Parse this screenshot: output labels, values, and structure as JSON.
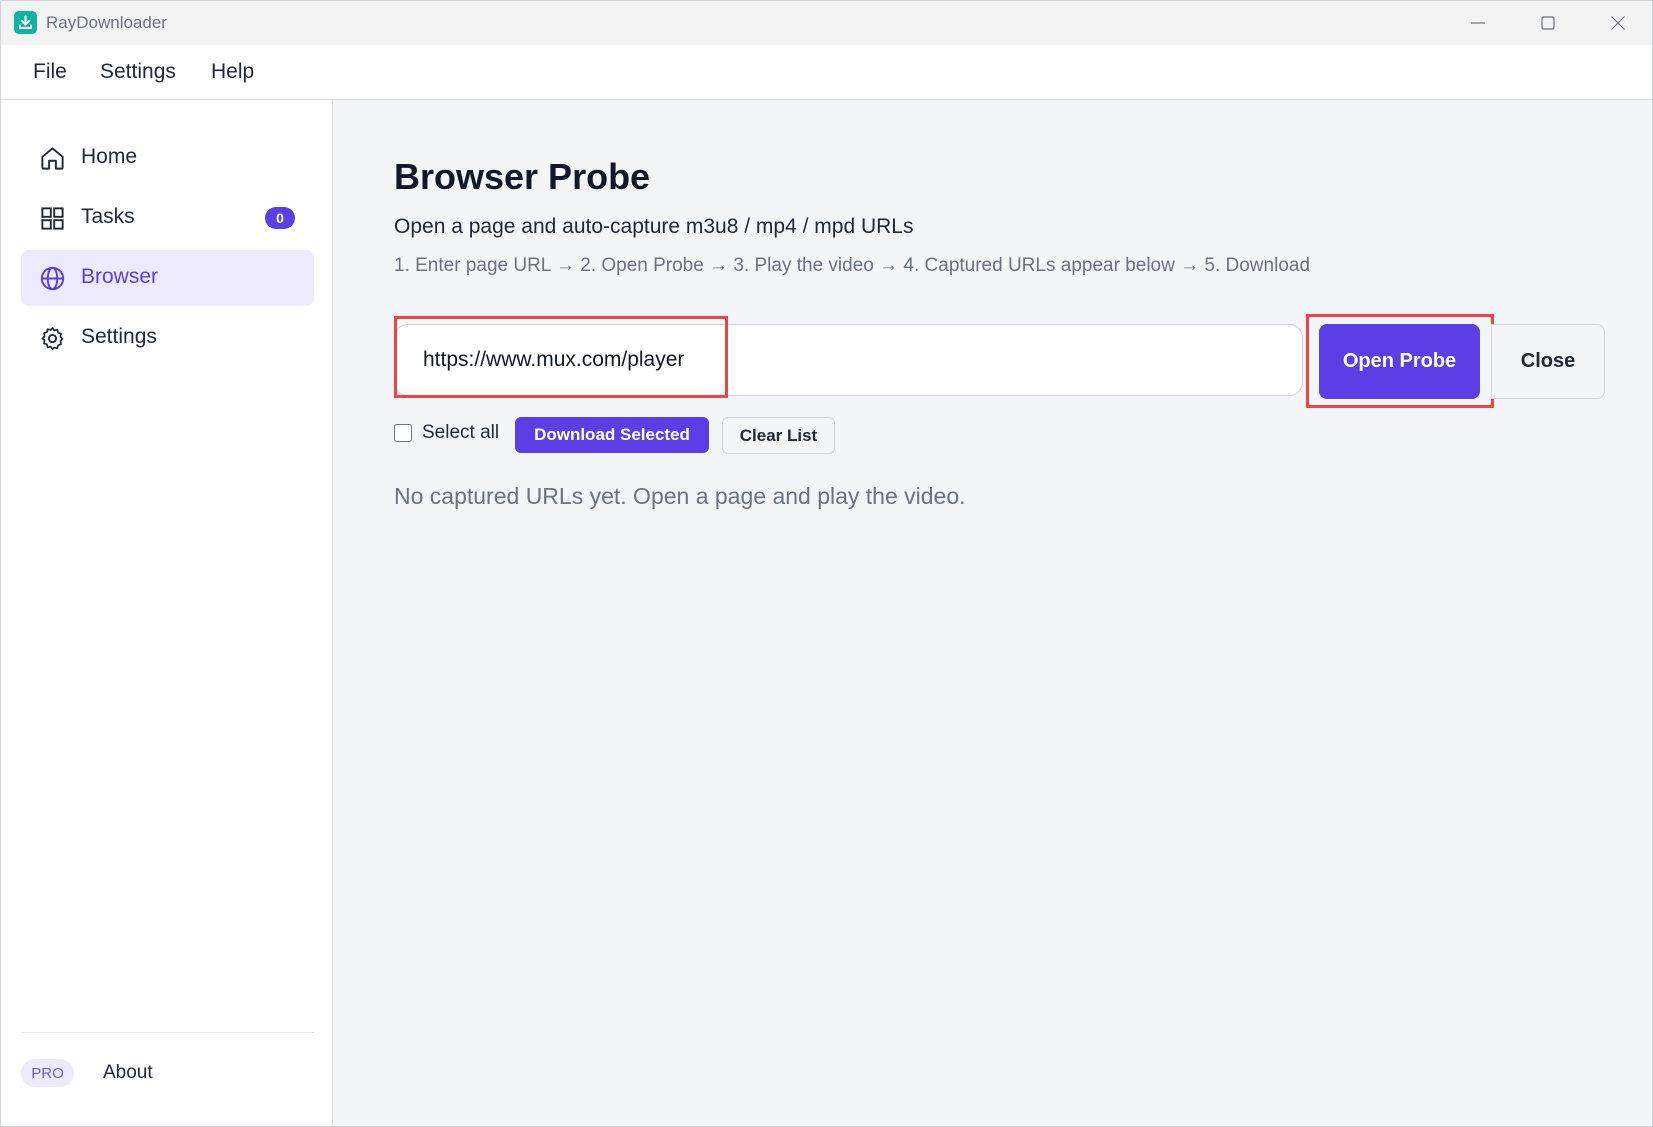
{
  "window": {
    "title": "RayDownloader",
    "icons": {
      "logo": "download-logo-icon",
      "minimize": "minimize-icon",
      "maximize": "maximize-icon",
      "close": "close-icon"
    }
  },
  "menu": {
    "items": [
      "File",
      "Settings",
      "Help"
    ]
  },
  "sidebar": {
    "items": [
      {
        "label": "Home",
        "icon": "home-icon"
      },
      {
        "label": "Tasks",
        "icon": "grid-icon",
        "badge": "0"
      },
      {
        "label": "Browser",
        "icon": "globe-icon",
        "active": true
      },
      {
        "label": "Settings",
        "icon": "gear-icon"
      }
    ],
    "footer": {
      "pro_label": "PRO",
      "about_label": "About"
    }
  },
  "main": {
    "title": "Browser Probe",
    "subtitle": "Open a page and auto-capture m3u8 / mp4 / mpd URLs",
    "steps": "1. Enter page URL → 2. Open Probe → 3. Play the video → 4. Captured URLs appear below → 5. Download",
    "url_input": {
      "value": "https://www.mux.com/player"
    },
    "open_probe_label": "Open Probe",
    "close_label": "Close",
    "select_all_label": "Select all",
    "select_all_checked": false,
    "download_selected_label": "Download Selected",
    "clear_list_label": "Clear List",
    "empty_message": "No captured URLs yet. Open a page and play the video."
  },
  "colors": {
    "accent": "#5b3ee6",
    "accent_light": "#ede9fe",
    "highlight": "#ef4444",
    "logo": "#10b3a3"
  }
}
